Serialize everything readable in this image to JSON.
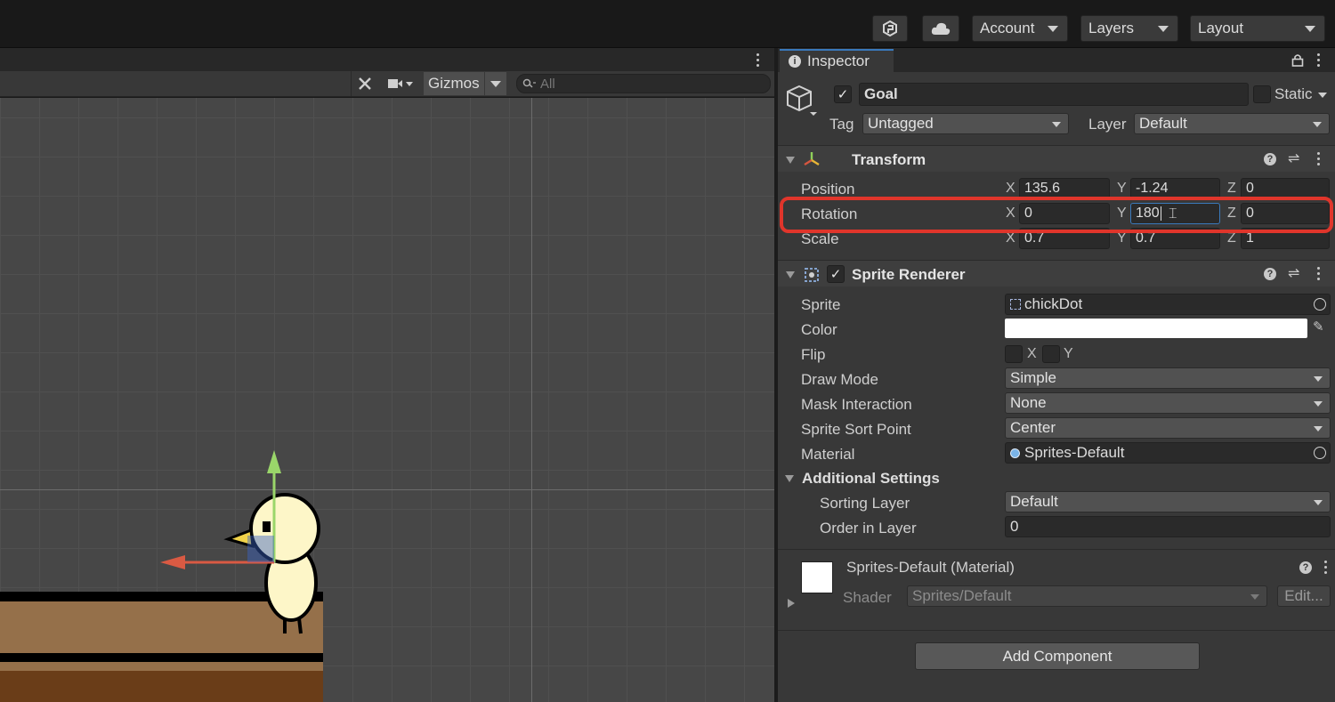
{
  "toolbar": {
    "collab_icon": "collab-icon",
    "cloud_icon": "cloud-icon",
    "account_label": "Account",
    "layers_label": "Layers",
    "layout_label": "Layout"
  },
  "scene": {
    "gizmos_label": "Gizmos",
    "search_placeholder": "All"
  },
  "inspector": {
    "tab_label": "Inspector",
    "object_name": "Goal",
    "active": true,
    "static_label": "Static",
    "tag_label": "Tag",
    "tag_value": "Untagged",
    "layer_label": "Layer",
    "layer_value": "Default"
  },
  "transform": {
    "title": "Transform",
    "position_label": "Position",
    "rotation_label": "Rotation",
    "scale_label": "Scale",
    "axis_x": "X",
    "axis_y": "Y",
    "axis_z": "Z",
    "position": {
      "x": "135.6",
      "y": "-1.24",
      "z": "0"
    },
    "rotation": {
      "x": "0",
      "y": "180",
      "z": "0"
    },
    "scale": {
      "x": "0.7",
      "y": "0.7",
      "z": "1"
    }
  },
  "sprite_renderer": {
    "title": "Sprite Renderer",
    "sprite_label": "Sprite",
    "sprite_value": "chickDot",
    "color_label": "Color",
    "color_value": "#ffffff",
    "flip_label": "Flip",
    "flip_x": "X",
    "flip_y": "Y",
    "draw_mode_label": "Draw Mode",
    "draw_mode_value": "Simple",
    "mask_label": "Mask Interaction",
    "mask_value": "None",
    "sort_point_label": "Sprite Sort Point",
    "sort_point_value": "Center",
    "material_label": "Material",
    "material_value": "Sprites-Default",
    "additional_label": "Additional Settings",
    "sorting_layer_label": "Sorting Layer",
    "sorting_layer_value": "Default",
    "order_label": "Order in Layer",
    "order_value": "0"
  },
  "material": {
    "title": "Sprites-Default (Material)",
    "shader_label": "Shader",
    "shader_value": "Sprites/Default",
    "edit_label": "Edit..."
  },
  "add_component_label": "Add Component",
  "colors": {
    "highlight": "#e0352b",
    "tab_accent": "#3a79bb",
    "gizmo_y": "#9ad66a",
    "gizmo_x": "#d95a43"
  }
}
